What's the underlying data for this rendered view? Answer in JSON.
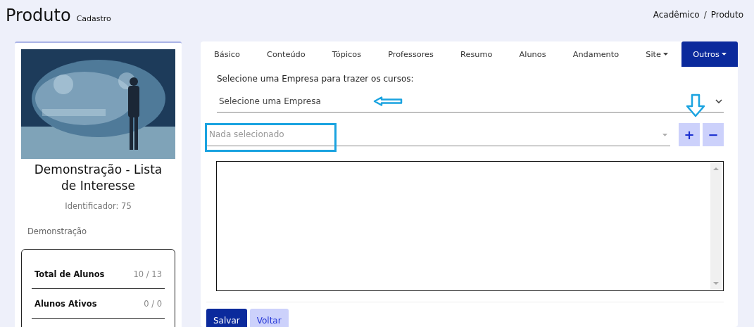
{
  "header": {
    "title": "Produto",
    "subtitle": "Cadastro"
  },
  "breadcrumb": [
    "Acadêmico",
    "Produto"
  ],
  "breadcrumb_separator": "/",
  "product_card": {
    "title": "Demonstração - Lista de Interesse",
    "identifier": "Identificador: 75",
    "category": "Demonstração",
    "stats": [
      {
        "label": "Total de Alunos",
        "value": "10 / 13"
      },
      {
        "label": "Alunos Ativos",
        "value": "0 / 0"
      }
    ]
  },
  "tabs": [
    {
      "label": "Básico",
      "selected": false,
      "dropdown": false
    },
    {
      "label": "Conteúdo",
      "selected": false,
      "dropdown": false
    },
    {
      "label": "Tópicos",
      "selected": false,
      "dropdown": false
    },
    {
      "label": "Professores",
      "selected": false,
      "dropdown": false
    },
    {
      "label": "Resumo",
      "selected": false,
      "dropdown": false
    },
    {
      "label": "Alunos",
      "selected": false,
      "dropdown": false
    },
    {
      "label": "Andamento",
      "selected": false,
      "dropdown": false
    },
    {
      "label": "Site",
      "selected": false,
      "dropdown": true
    },
    {
      "label": "Outros",
      "selected": true,
      "dropdown": true
    }
  ],
  "form": {
    "company_label": "Selecione uma Empresa para trazer os cursos:",
    "company_select": {
      "value": "Selecione uma Empresa"
    },
    "course_select": {
      "placeholder": "Nada selecionado"
    },
    "add_button": "+",
    "remove_button": "−",
    "buttons": [
      {
        "label": "Salvar",
        "kind": "primary"
      },
      {
        "label": "Voltar",
        "kind": "secondary"
      }
    ]
  }
}
